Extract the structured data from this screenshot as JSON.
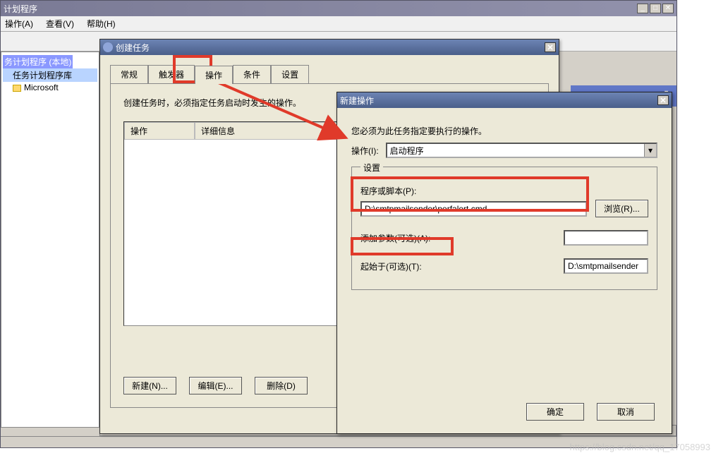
{
  "mainWindow": {
    "title": "计划程序",
    "menu": {
      "operation": "操作(A)",
      "view": "查看(V)",
      "help": "帮助(H)"
    },
    "tree": {
      "root": "务计划程序 (本地)",
      "lib": "任务计划程序库",
      "microsoft": "Microsoft"
    }
  },
  "dlg1": {
    "title": "创建任务",
    "tabs": {
      "general": "常规",
      "triggers": "触发器",
      "actions": "操作",
      "conditions": "条件",
      "settings": "设置"
    },
    "hint": "创建任务时，必须指定任务启动时发生的操作。",
    "cols": {
      "action": "操作",
      "detail": "详细信息"
    },
    "buttons": {
      "new": "新建(N)...",
      "edit": "编辑(E)...",
      "delete": "删除(D)"
    }
  },
  "dlg2": {
    "title": "新建操作",
    "hint": "您必须为此任务指定要执行的操作。",
    "actionLabel": "操作(I):",
    "actionValue": "启动程序",
    "settingsLegend": "设置",
    "programLabel": "程序或脚本(P):",
    "programValue": "D:\\smtpmailsender\\perfalert.cmd",
    "browse": "浏览(R)...",
    "argsLabel": "添加参数(可选)(A):",
    "argsValue": "",
    "startInLabel": "起始于(可选)(T):",
    "startInValue": "D:\\smtpmailsender",
    "ok": "确定",
    "cancel": "取消"
  },
  "watermark": "https://blog.csdn.net/qq_17058993"
}
